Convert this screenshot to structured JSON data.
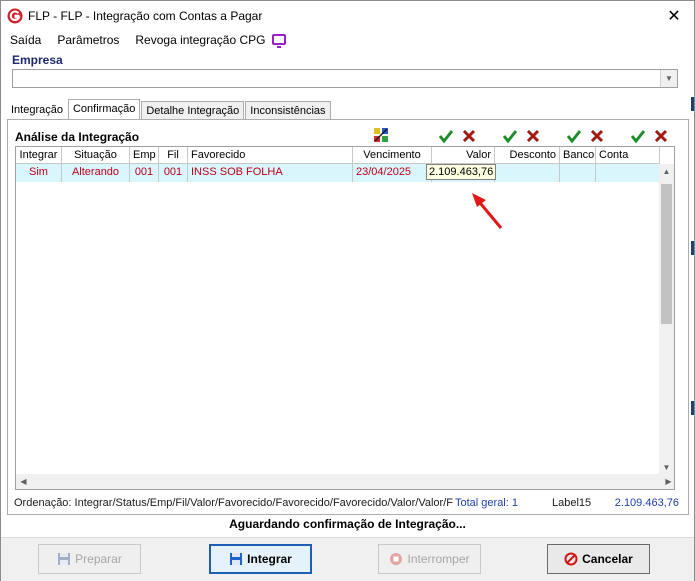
{
  "window": {
    "title": "FLP -  FLP - Integração com Contas a Pagar",
    "close_glyph": "✕"
  },
  "menubar": {
    "items": [
      "Saída",
      "Parâmetros",
      "Revoga integração CPG"
    ],
    "icon": "monitor-icon",
    "icon_color": "#9b1fc9"
  },
  "empresa": {
    "label": "Empresa",
    "value": ""
  },
  "tabs": [
    {
      "label": "Integração",
      "active": false
    },
    {
      "label": "Confirmação",
      "active": true
    },
    {
      "label": "Detalhe Integração",
      "active": false
    },
    {
      "label": "Inconsistências",
      "active": false
    }
  ],
  "panel": {
    "title": "Análise da Integração"
  },
  "grid": {
    "columns": [
      "Integrar",
      "Situação",
      "Emp",
      "Fil",
      "Favorecido",
      "Vencimento",
      "Valor",
      "Desconto",
      "Banco",
      "Conta"
    ],
    "rows": [
      {
        "integrar": "Sim",
        "situacao": "Alterando",
        "emp": "001",
        "fil": "001",
        "favorecido": "INSS SOB FOLHA",
        "vencimento": "23/04/2025",
        "valor": "",
        "desconto": "",
        "banco": "",
        "conta": ""
      }
    ],
    "tooltip": "2.109.463,76",
    "row_color": "#d8f6fb",
    "text_color": "#c0001a"
  },
  "footer_line": {
    "ordenacao": "Ordenação: Integrar/Status/Emp/Fil/Valor/Favorecido/Favorecido/Favorecido/Valor/Valor/F",
    "total_geral": "Total geral: 1",
    "label15": "Label15",
    "total_value": "2.109.463,76"
  },
  "status_message": "Aguardando confirmação de Integração...",
  "buttons": {
    "preparar": {
      "label": "Preparar",
      "enabled": false
    },
    "integrar": {
      "label": "Integrar",
      "enabled": true
    },
    "interromper": {
      "label": "Interromper",
      "enabled": false
    },
    "cancelar": {
      "label": "Cancelar",
      "enabled": true
    }
  }
}
